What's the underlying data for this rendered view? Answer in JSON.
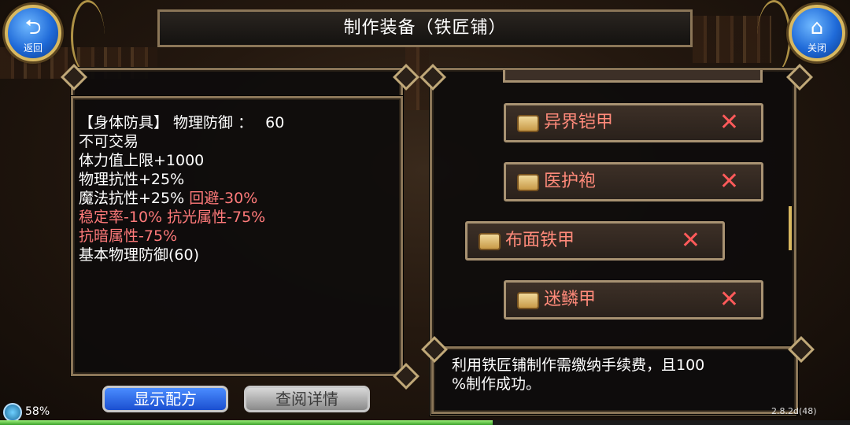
{
  "header": {
    "title": "制作装备（铁匠铺）"
  },
  "nav": {
    "back": {
      "label": "返回",
      "icon": "back-arrow-icon"
    },
    "close": {
      "label": "关闭",
      "icon": "home-icon"
    }
  },
  "item_details": {
    "line1_label": "【身体防具】 物理防御 ：",
    "line1_value": "60",
    "line2": "不可交易",
    "line3": "体力值上限+1000",
    "line4": "物理抗性+25%",
    "line5a": "魔法抗性+25%",
    "line5b": "回避-30%",
    "line6": "稳定率-10% 抗光属性-75%",
    "line7": "抗暗属性-75%",
    "line8": "基本物理防御(60)"
  },
  "recipe_list": [
    {
      "name": "异界铠甲",
      "status": "unavailable"
    },
    {
      "name": "医护袍",
      "status": "unavailable"
    },
    {
      "name": "布面铁甲",
      "status": "unavailable",
      "selected": true
    },
    {
      "name": "迷鳞甲",
      "status": "unavailable"
    }
  ],
  "footer_note": {
    "line1": "利用铁匠铺制作需缴纳手续费，且100",
    "line2": "%制作成功。"
  },
  "buttons": {
    "show_recipe": "显示配方",
    "view_details": "查阅详情"
  },
  "status_bar": {
    "battery": "58%",
    "version": "2.8.2d(48)"
  },
  "colors": {
    "item_name": "#ff8a7a",
    "penalty_text": "#ff7a7a",
    "frame_border": "#8b7658",
    "button_blue": "#1f62e0"
  }
}
